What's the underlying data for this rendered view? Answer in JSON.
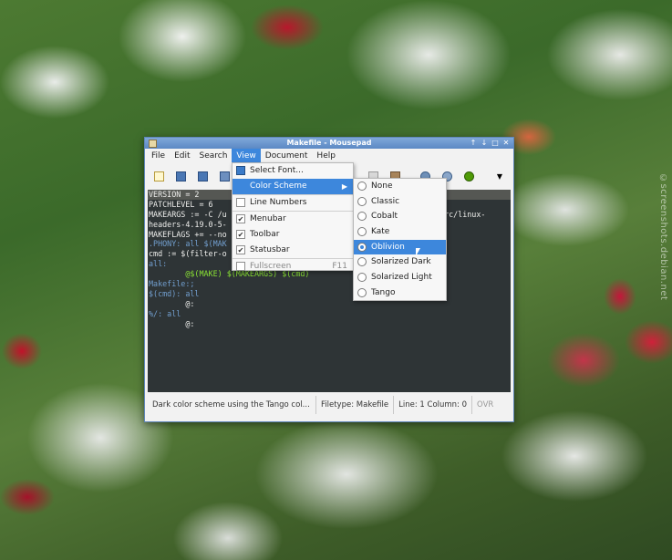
{
  "window": {
    "title": "Makefile - Mousepad",
    "controls": [
      "↑",
      "↓",
      "□",
      "✕"
    ]
  },
  "menubar": [
    "File",
    "Edit",
    "Search",
    "View",
    "Document",
    "Help"
  ],
  "toolbar_icons": [
    "new-document-icon",
    "open-file-icon",
    "save-icon",
    "save-as-icon",
    "cut-icon",
    "paste-icon",
    "find-icon",
    "find-replace-icon",
    "go-to-line-icon",
    "dropdown-arrow-icon"
  ],
  "editor": {
    "lines": [
      "VERSION = 2",
      "PATCHLEVEL = 6",
      "MAKEARGS := -C /u",
      "headers-4.19.0-5-",
      "MAKEFLAGS += --no",
      ".PHONY: all $(MAK",
      "cmd := $(filter-o",
      "all:",
      "        @$(MAKE) $(MAKEARGS) $(cmd)",
      "Makefile:;",
      "$(cmd): all",
      "        @:",
      "%/: all",
      "        @:"
    ],
    "obscured_fragment": "src/linux-"
  },
  "view_menu": {
    "items": [
      {
        "label": "Select Font...",
        "type": "icon"
      },
      {
        "label": "Color Scheme",
        "type": "submenu"
      },
      {
        "label": "Line Numbers",
        "type": "check",
        "checked": false
      },
      {
        "label": "Menubar",
        "type": "check",
        "checked": true
      },
      {
        "label": "Toolbar",
        "type": "check",
        "checked": true
      },
      {
        "label": "Statusbar",
        "type": "check",
        "checked": true
      },
      {
        "label": "Fullscreen",
        "type": "check",
        "checked": false,
        "shortcut": "F11"
      }
    ]
  },
  "color_schemes": {
    "items": [
      "None",
      "Classic",
      "Cobalt",
      "Kate",
      "Oblivion",
      "Solarized Dark",
      "Solarized Light",
      "Tango"
    ],
    "selected": "Oblivion"
  },
  "statusbar": {
    "description": "Dark color scheme using the Tango col...",
    "filetype": "Filetype: Makefile",
    "position": "Line: 1 Column: 0",
    "mode": "OVR"
  },
  "watermark": "©screenshots.debian.net"
}
